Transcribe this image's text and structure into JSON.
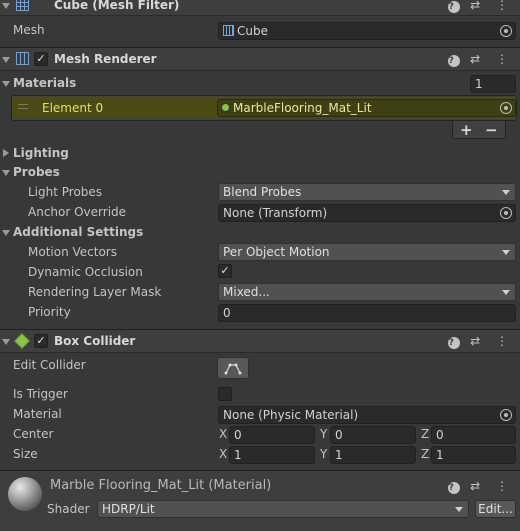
{
  "mesh_filter": {
    "title": "Cube (Mesh Filter)",
    "mesh_label": "Mesh",
    "mesh_value": "Cube"
  },
  "mesh_renderer": {
    "title": "Mesh Renderer",
    "materials_label": "Materials",
    "materials_count": "1",
    "element_label": "Element 0",
    "element_value": "MarbleFlooring_Mat_Lit",
    "add_label": "+",
    "remove_label": "−",
    "lighting_label": "Lighting",
    "probes_label": "Probes",
    "light_probes_label": "Light Probes",
    "light_probes_value": "Blend Probes",
    "anchor_override_label": "Anchor Override",
    "anchor_override_value": "None (Transform)",
    "additional_settings_label": "Additional Settings",
    "motion_vectors_label": "Motion Vectors",
    "motion_vectors_value": "Per Object Motion",
    "dynamic_occlusion_label": "Dynamic Occlusion",
    "dynamic_occlusion_checked": "✓",
    "rendering_layer_mask_label": "Rendering Layer Mask",
    "rendering_layer_mask_value": "Mixed...",
    "priority_label": "Priority",
    "priority_value": "0"
  },
  "box_collider": {
    "title": "Box Collider",
    "edit_collider_label": "Edit Collider",
    "is_trigger_label": "Is Trigger",
    "material_label": "Material",
    "material_value": "None (Physic Material)",
    "center_label": "Center",
    "size_label": "Size",
    "x_label": "X",
    "y_label": "Y",
    "z_label": "Z",
    "center": {
      "x": "0",
      "y": "0",
      "z": "0"
    },
    "size": {
      "x": "1",
      "y": "1",
      "z": "1"
    }
  },
  "material": {
    "title": "Marble Flooring_Mat_Lit (Material)",
    "shader_label": "Shader",
    "shader_value": "HDRP/Lit",
    "edit_label": "Edit..."
  },
  "header_icons": {
    "help": "?",
    "presets": "⇄",
    "menu": "⋮"
  },
  "colors": {
    "highlight": "#4a4a14",
    "accent_green": "#8bc34a"
  }
}
